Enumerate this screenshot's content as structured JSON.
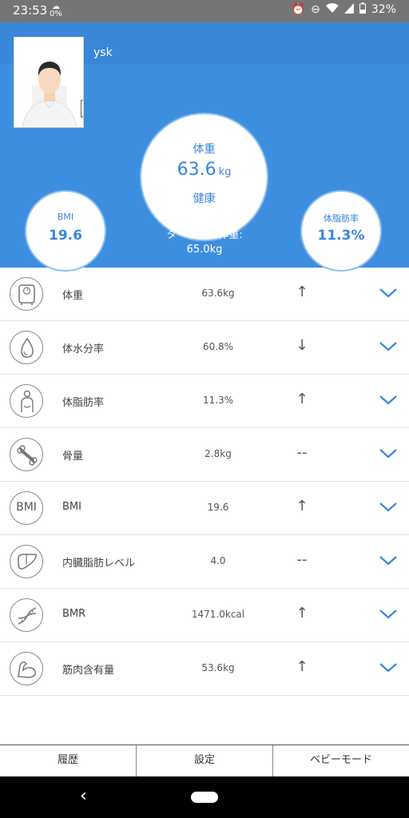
{
  "status_bar": {
    "time": "23:53",
    "precip": "0%",
    "battery": "32%",
    "icons": [
      "alarm-icon",
      "do-not-disturb-icon",
      "wifi-icon",
      "signal-icon",
      "battery-icon"
    ]
  },
  "profile": {
    "username": "ysk"
  },
  "weight": {
    "label": "体重",
    "value": "63.6",
    "unit": "kg",
    "status": "健康"
  },
  "bmi": {
    "label": "BMI",
    "value": "19.6"
  },
  "body_fat": {
    "label": "体脂肪率",
    "value": "11.3%"
  },
  "target": {
    "label": "ターゲット体重:",
    "value": "65.0kg"
  },
  "metrics": [
    {
      "icon": "scale-icon",
      "name": "体重",
      "value": "63.6kg",
      "trend": "↑"
    },
    {
      "icon": "water-drop-icon",
      "name": "体水分率",
      "value": "60.8%",
      "trend": "↓"
    },
    {
      "icon": "body-fat-icon",
      "name": "体脂肪率",
      "value": "11.3%",
      "trend": "↑"
    },
    {
      "icon": "bone-icon",
      "name": "骨量",
      "value": "2.8kg",
      "trend": "--"
    },
    {
      "icon": "bmi-icon",
      "name": "BMI",
      "value": "19.6",
      "trend": "↑"
    },
    {
      "icon": "liver-icon",
      "name": "内臓脂肪レベル",
      "value": "4.0",
      "trend": "--"
    },
    {
      "icon": "dna-icon",
      "name": "BMR",
      "value": "1471.0kcal",
      "trend": "↑"
    },
    {
      "icon": "muscle-icon",
      "name": "筋肉含有量",
      "value": "53.6kg",
      "trend": "↑"
    }
  ],
  "bmi_icon_text": "BMI",
  "tabs": {
    "history": "履歴",
    "settings": "設定",
    "baby_mode": "ベビーモード"
  },
  "colors": {
    "header": "#3e8ee0",
    "accent": "#3a86d9",
    "chevron": "#3a86d9"
  }
}
